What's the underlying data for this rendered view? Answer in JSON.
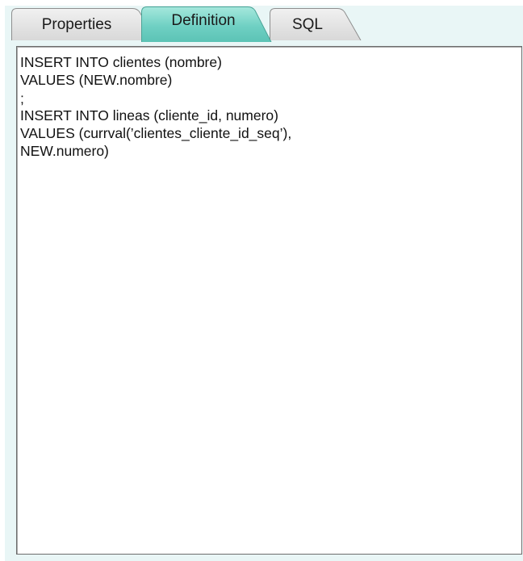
{
  "tabs": [
    {
      "label": "Properties",
      "active": false
    },
    {
      "label": "Definition",
      "active": true
    },
    {
      "label": "SQL",
      "active": false
    }
  ],
  "colors": {
    "panel_bg": "#e9f6f6",
    "active_tab": "#6fd0c3",
    "inactive_tab": "#e0e0e0",
    "editor_bg": "#ffffff",
    "editor_border": "#6d6d6d"
  },
  "editor": {
    "lines": [
      "INSERT INTO clientes (nombre)",
      "VALUES (NEW.nombre)",
      ";",
      "INSERT INTO lineas (cliente_id, numero)",
      "VALUES (currval(’clientes_cliente_id_seq’),",
      "NEW.numero)"
    ]
  }
}
